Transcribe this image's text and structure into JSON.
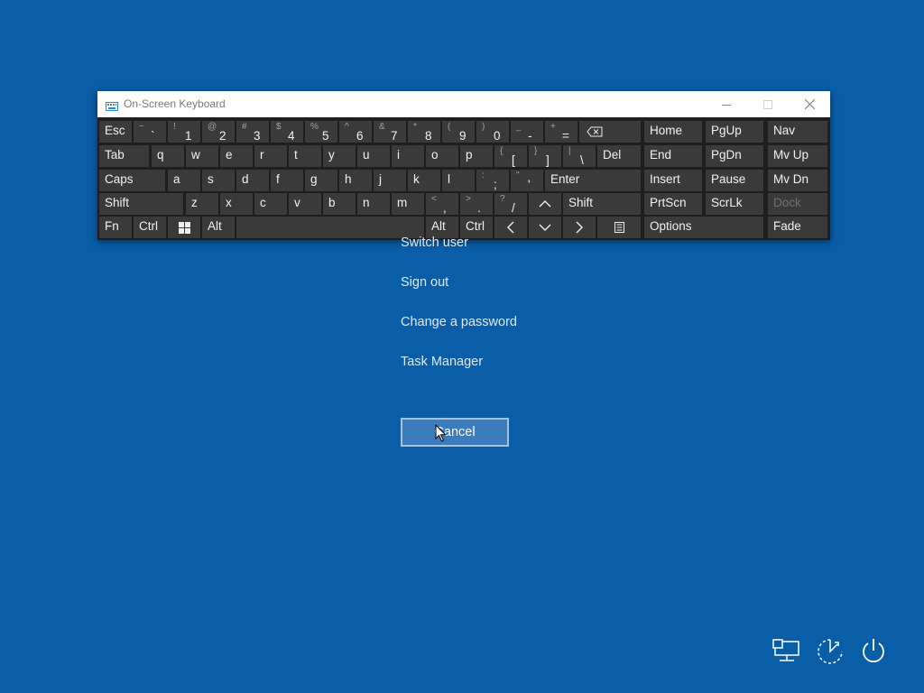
{
  "menu": {
    "items": [
      "Switch user",
      "Sign out",
      "Change a password",
      "Task Manager"
    ],
    "cancel_label": "Cancel"
  },
  "osk": {
    "title": "On-Screen Keyboard",
    "row1": [
      {
        "shift": "",
        "main": "Esc"
      },
      {
        "shift": "~",
        "main": "`"
      },
      {
        "shift": "!",
        "main": "1"
      },
      {
        "shift": "@",
        "main": "2"
      },
      {
        "shift": "#",
        "main": "3"
      },
      {
        "shift": "$",
        "main": "4"
      },
      {
        "shift": "%",
        "main": "5"
      },
      {
        "shift": "^",
        "main": "6"
      },
      {
        "shift": "&",
        "main": "7"
      },
      {
        "shift": "*",
        "main": "8"
      },
      {
        "shift": "(",
        "main": "9"
      },
      {
        "shift": ")",
        "main": "0"
      },
      {
        "shift": "_",
        "main": "-"
      },
      {
        "shift": "+",
        "main": "="
      },
      {
        "shift": "",
        "main": ""
      }
    ],
    "row2": [
      {
        "shift": "",
        "main": "Tab"
      },
      {
        "shift": "",
        "main": "q"
      },
      {
        "shift": "",
        "main": "w"
      },
      {
        "shift": "",
        "main": "e"
      },
      {
        "shift": "",
        "main": "r"
      },
      {
        "shift": "",
        "main": "t"
      },
      {
        "shift": "",
        "main": "y"
      },
      {
        "shift": "",
        "main": "u"
      },
      {
        "shift": "",
        "main": "i"
      },
      {
        "shift": "",
        "main": "o"
      },
      {
        "shift": "",
        "main": "p"
      },
      {
        "shift": "{",
        "main": "["
      },
      {
        "shift": "}",
        "main": "]"
      },
      {
        "shift": "|",
        "main": "\\"
      },
      {
        "shift": "",
        "main": "Del"
      }
    ],
    "row3": [
      {
        "shift": "",
        "main": "Caps"
      },
      {
        "shift": "",
        "main": "a"
      },
      {
        "shift": "",
        "main": "s"
      },
      {
        "shift": "",
        "main": "d"
      },
      {
        "shift": "",
        "main": "f"
      },
      {
        "shift": "",
        "main": "g"
      },
      {
        "shift": "",
        "main": "h"
      },
      {
        "shift": "",
        "main": "j"
      },
      {
        "shift": "",
        "main": "k"
      },
      {
        "shift": "",
        "main": "l"
      },
      {
        "shift": ":",
        "main": ";"
      },
      {
        "shift": "\"",
        "main": "'"
      },
      {
        "shift": "",
        "main": "Enter"
      }
    ],
    "row4": [
      {
        "shift": "",
        "main": "Shift"
      },
      {
        "shift": "",
        "main": "z"
      },
      {
        "shift": "",
        "main": "x"
      },
      {
        "shift": "",
        "main": "c"
      },
      {
        "shift": "",
        "main": "v"
      },
      {
        "shift": "",
        "main": "b"
      },
      {
        "shift": "",
        "main": "n"
      },
      {
        "shift": "",
        "main": "m"
      },
      {
        "shift": "<",
        "main": ","
      },
      {
        "shift": ">",
        "main": "."
      },
      {
        "shift": "?",
        "main": "/"
      },
      {
        "shift": "",
        "main": ""
      },
      {
        "shift": "",
        "main": "Shift"
      }
    ],
    "row5": [
      {
        "shift": "",
        "main": "Fn"
      },
      {
        "shift": "",
        "main": "Ctrl"
      },
      {
        "shift": "",
        "main": ""
      },
      {
        "shift": "",
        "main": "Alt"
      },
      {
        "shift": "",
        "main": ""
      },
      {
        "shift": "",
        "main": "Alt"
      },
      {
        "shift": "",
        "main": "Ctrl"
      },
      {
        "shift": "",
        "main": ""
      },
      {
        "shift": "",
        "main": ""
      },
      {
        "shift": "",
        "main": ""
      },
      {
        "shift": "",
        "main": ""
      }
    ],
    "nav": [
      "Home",
      "PgUp",
      "Nav",
      "End",
      "PgDn",
      "Mv Up",
      "Insert",
      "Pause",
      "Mv Dn",
      "PrtScn",
      "ScrLk",
      "Dock",
      "Options",
      "Fade"
    ]
  },
  "icons": {
    "title": "keyboard-icon",
    "minimize": "minimize-icon",
    "maximize": "maximize-icon",
    "close": "close-icon",
    "backspace": "backspace-icon",
    "windows": "windows-logo-icon",
    "up": "up-arrow-icon",
    "down": "down-arrow-icon",
    "left": "left-arrow-icon",
    "right": "right-arrow-icon",
    "menu": "context-menu-icon",
    "network": "network-icon",
    "accessibility": "ease-of-access-icon",
    "power": "power-icon",
    "cursor": "mouse-pointer-icon"
  },
  "colors": {
    "background": "#0a5ea8",
    "key": "#3a3a3a",
    "keyboard": "#1e1e1e"
  }
}
